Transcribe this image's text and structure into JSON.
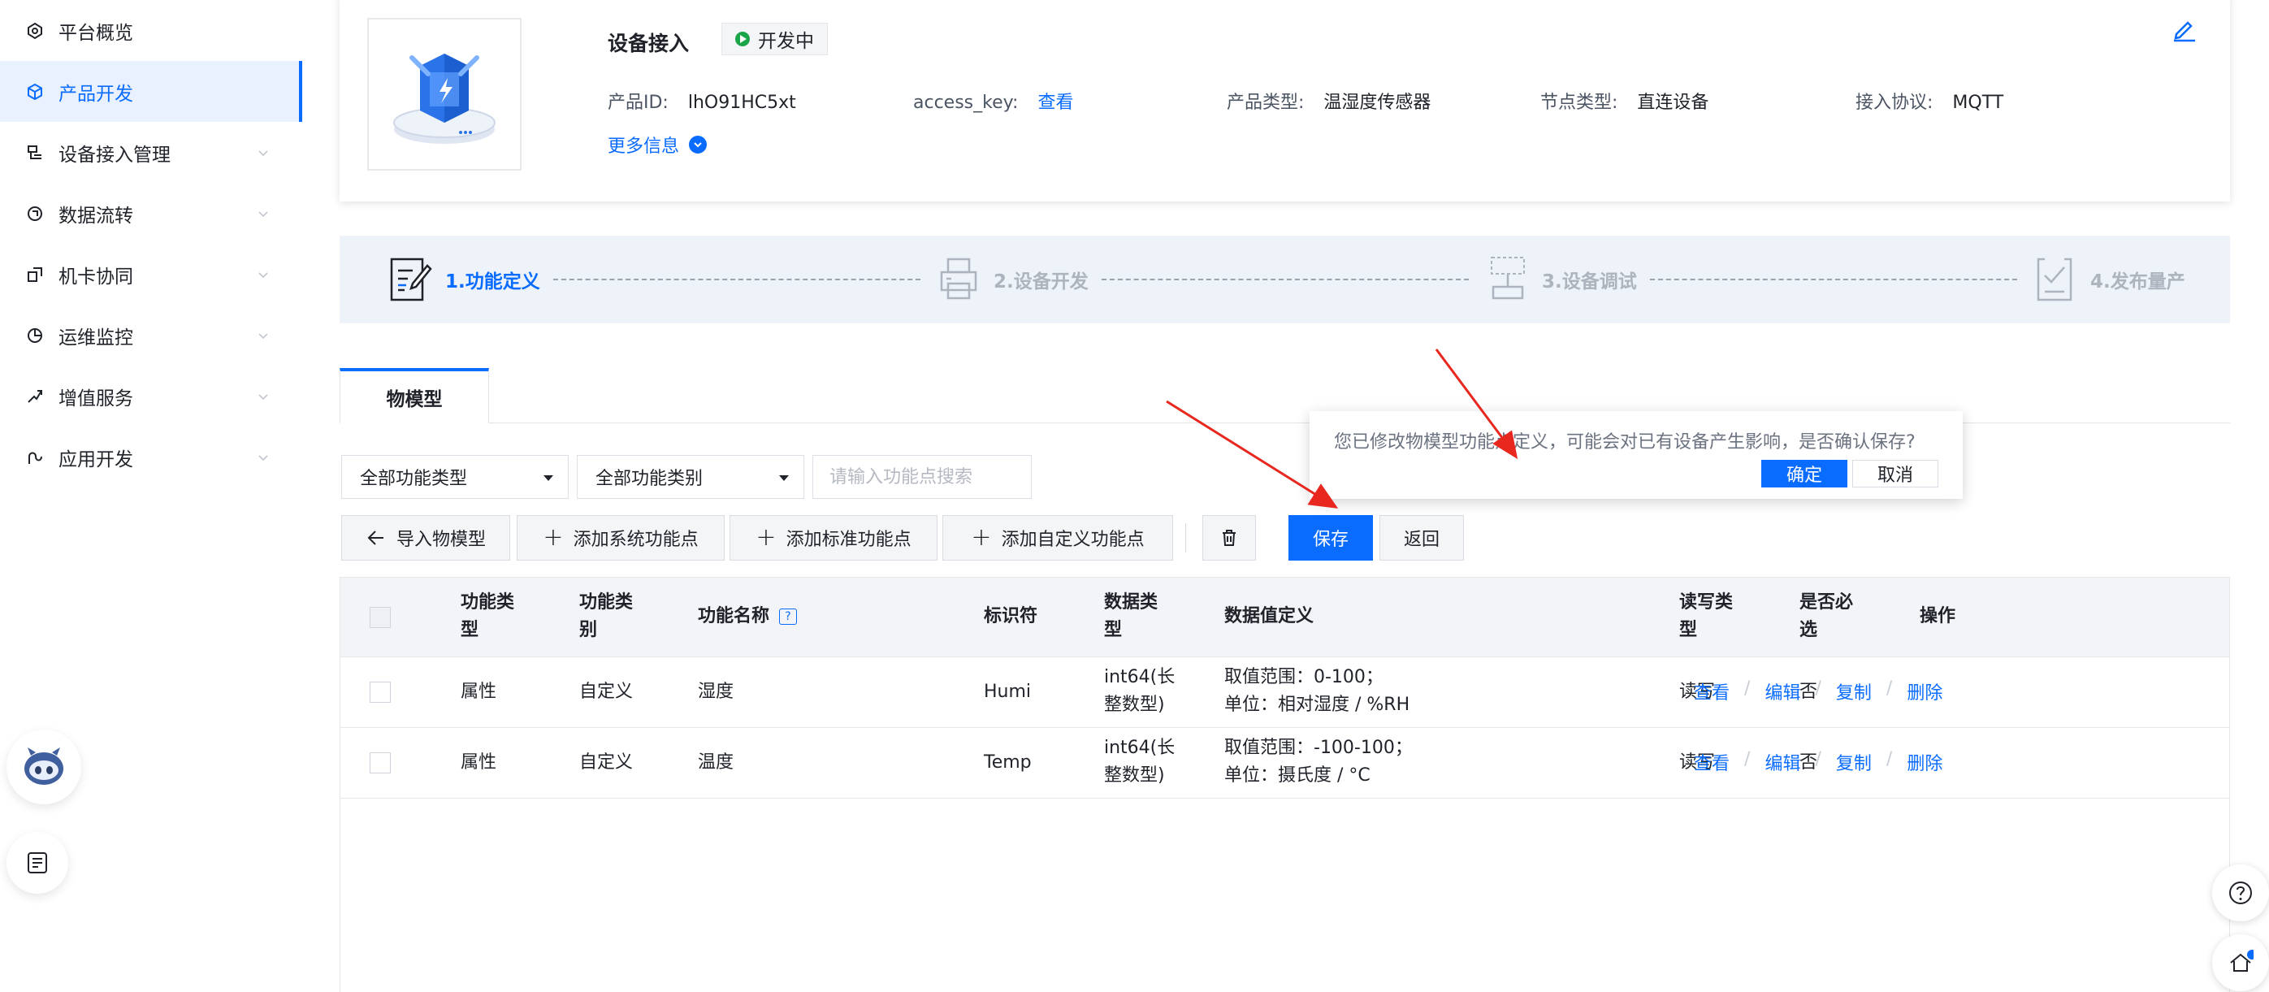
{
  "sidebar": {
    "items": [
      {
        "label": "平台概览",
        "icon": "overview-icon",
        "expandable": false
      },
      {
        "label": "产品开发",
        "icon": "cube-icon",
        "expandable": false,
        "active": true
      },
      {
        "label": "设备接入管理",
        "icon": "device-icon",
        "expandable": true
      },
      {
        "label": "数据流转",
        "icon": "flow-icon",
        "expandable": true
      },
      {
        "label": "机卡协同",
        "icon": "link-icon",
        "expandable": true
      },
      {
        "label": "运维监控",
        "icon": "monitor-icon",
        "expandable": true
      },
      {
        "label": "增值服务",
        "icon": "service-icon",
        "expandable": true
      },
      {
        "label": "应用开发",
        "icon": "app-icon",
        "expandable": true
      }
    ]
  },
  "product": {
    "name": "设备接入",
    "status": "开发中",
    "id_label": "产品ID:",
    "id_value": "lhO91HC5xt",
    "access_key_label": "access_key:",
    "access_key_link": "查看",
    "type_label": "产品类型:",
    "type_value": "温湿度传感器",
    "node_label": "节点类型:",
    "node_value": "直连设备",
    "protocol_label": "接入协议:",
    "protocol_value": "MQTT",
    "more_info": "更多信息"
  },
  "steps": [
    {
      "label": "1.功能定义",
      "active": true
    },
    {
      "label": "2.设备开发",
      "active": false
    },
    {
      "label": "3.设备调试",
      "active": false
    },
    {
      "label": "4.发布量产",
      "active": false
    }
  ],
  "tabs": [
    {
      "label": "物模型",
      "active": true
    }
  ],
  "filters": {
    "function_type": "全部功能类型",
    "function_category": "全部功能类别",
    "search_placeholder": "请输入功能点搜索"
  },
  "toolbar": {
    "import": "导入物模型",
    "add_system": "添加系统功能点",
    "add_standard": "添加标准功能点",
    "add_custom": "添加自定义功能点",
    "save": "保存",
    "back": "返回"
  },
  "table": {
    "headers": {
      "type": [
        "功能类",
        "型"
      ],
      "category": [
        "功能类",
        "别"
      ],
      "name": "功能名称",
      "identifier": "标识符",
      "data_type": [
        "数据类",
        "型"
      ],
      "definition": "数据值定义",
      "rw": [
        "读写类",
        "型"
      ],
      "required": [
        "是否必",
        "选"
      ],
      "ops": "操作"
    },
    "rows": [
      {
        "type": "属性",
        "category": "自定义",
        "name": "湿度",
        "identifier": "Humi",
        "data_type": [
          "int64(长",
          "整数型)"
        ],
        "definition": [
          "取值范围：0-100；",
          "单位：相对湿度 / %RH"
        ],
        "rw": "读写",
        "required": "否"
      },
      {
        "type": "属性",
        "category": "自定义",
        "name": "温度",
        "identifier": "Temp",
        "data_type": [
          "int64(长",
          "整数型)"
        ],
        "definition": [
          "取值范围：-100-100；",
          "单位：摄氏度 / °C"
        ],
        "rw": "读写",
        "required": "否"
      }
    ],
    "ops": {
      "view": "查看",
      "edit": "编辑",
      "copy": "复制",
      "delete": "删除"
    }
  },
  "popconfirm": {
    "message": "您已修改物模型功能点定义，可能会对已有设备产生影响，是否确认保存?",
    "ok": "确定",
    "cancel": "取消"
  },
  "colors": {
    "accent": "#0a6cff",
    "status_green": "#1aa548",
    "annotation_red": "#e8271e"
  }
}
